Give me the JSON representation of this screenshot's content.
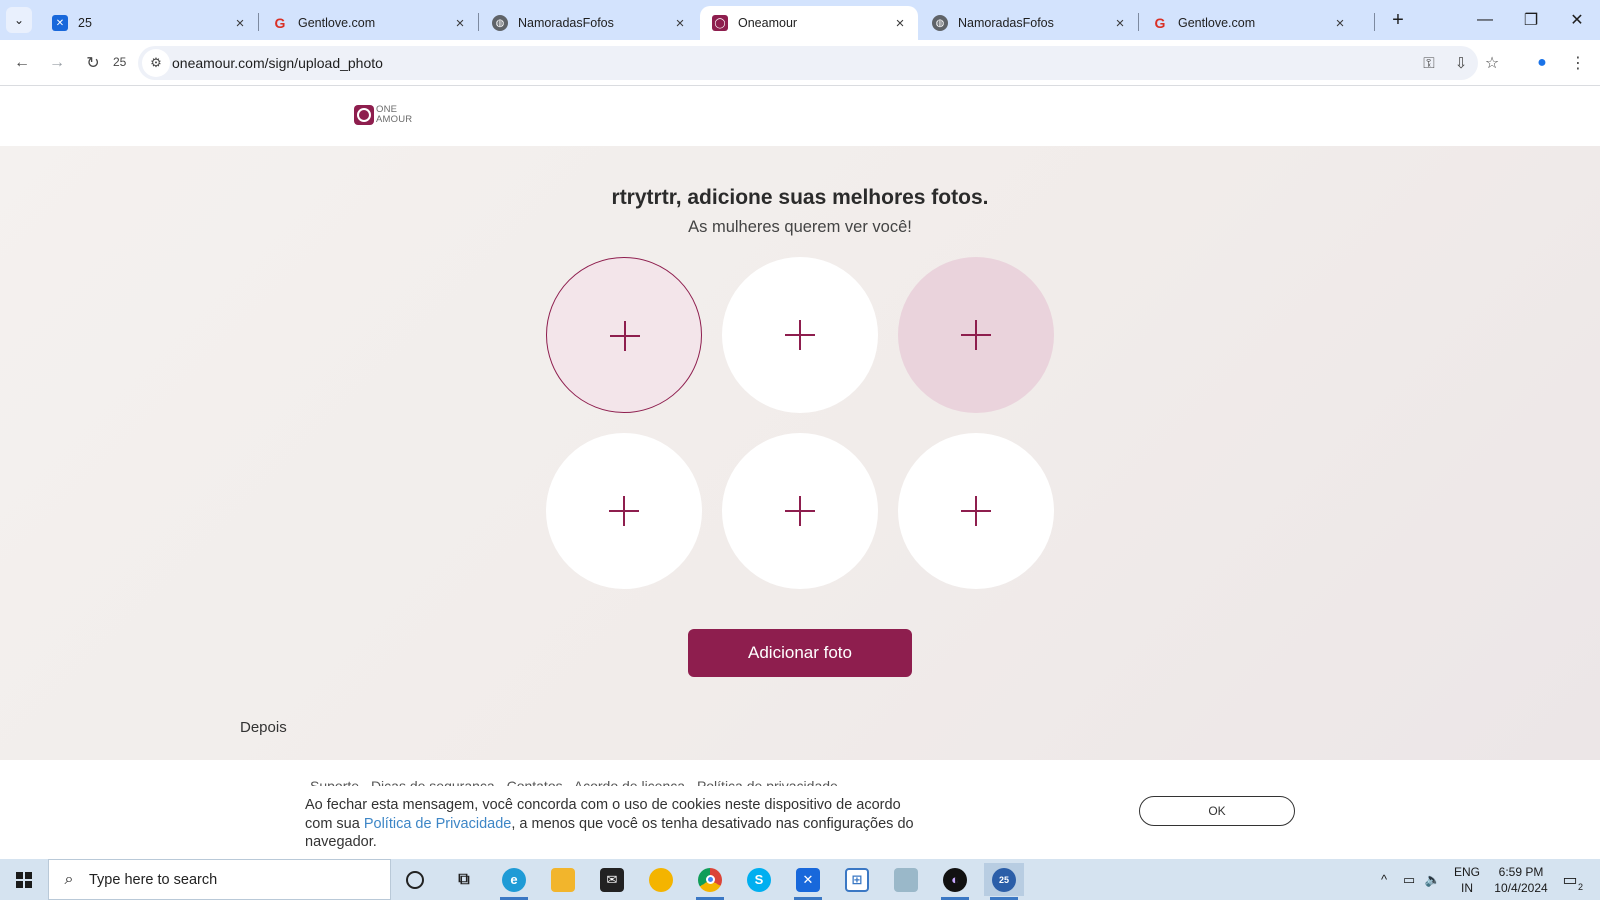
{
  "browser": {
    "tabs": [
      {
        "title": "25",
        "favicon": "jira-icon",
        "active": false
      },
      {
        "title": "Gentlove.com",
        "favicon": "google-g-icon",
        "active": false
      },
      {
        "title": "NamoradasFofos",
        "favicon": "globe-icon",
        "active": false
      },
      {
        "title": "Oneamour",
        "favicon": "oneamour-icon",
        "active": true
      },
      {
        "title": "NamoradasFofos",
        "favicon": "globe-icon",
        "active": false
      },
      {
        "title": "Gentlove.com",
        "favicon": "google-g-icon",
        "active": false
      }
    ],
    "reload_badge": "25",
    "url": "oneamour.com/sign/upload_photo"
  },
  "site": {
    "logo_text_1": "ONE",
    "logo_text_2": "AMOUR",
    "brand_color": "#8e1e4e"
  },
  "upload": {
    "heading": "rtrytrtr, adicione suas melhores fotos.",
    "subheading": "As mulheres querem ver você!",
    "slots": [
      {
        "state": "selected"
      },
      {
        "state": "empty"
      },
      {
        "state": "hover"
      },
      {
        "state": "empty"
      },
      {
        "state": "empty"
      },
      {
        "state": "empty"
      }
    ],
    "add_button": "Adicionar foto",
    "later_link": "Depois"
  },
  "footer": {
    "links": [
      "Suporte",
      "Dicas de segurança",
      "Contatos",
      "Acordo de licença",
      "Política de privacidade"
    ]
  },
  "cookie": {
    "text_before": "Ao fechar esta mensagem, você concorda com o uso de cookies neste dispositivo de acordo com sua ",
    "link": "Política de Privacidade",
    "text_after": ", a menos que você os tenha desativado nas configurações do navegador.",
    "ok_button": "OK"
  },
  "taskbar": {
    "search_placeholder": "Type here to search",
    "apps": [
      "cortana-icon",
      "task-view-icon",
      "edge-icon",
      "file-explorer-icon",
      "mail-icon",
      "chrome-canary-icon",
      "chrome-icon",
      "skype-icon",
      "jira-icon",
      "snipping-icon",
      "notepad-icon",
      "obs-icon",
      "app-25-icon"
    ],
    "lang_1": "ENG",
    "lang_2": "IN",
    "time": "6:59 PM",
    "date": "10/4/2024",
    "notification_count": "2"
  }
}
